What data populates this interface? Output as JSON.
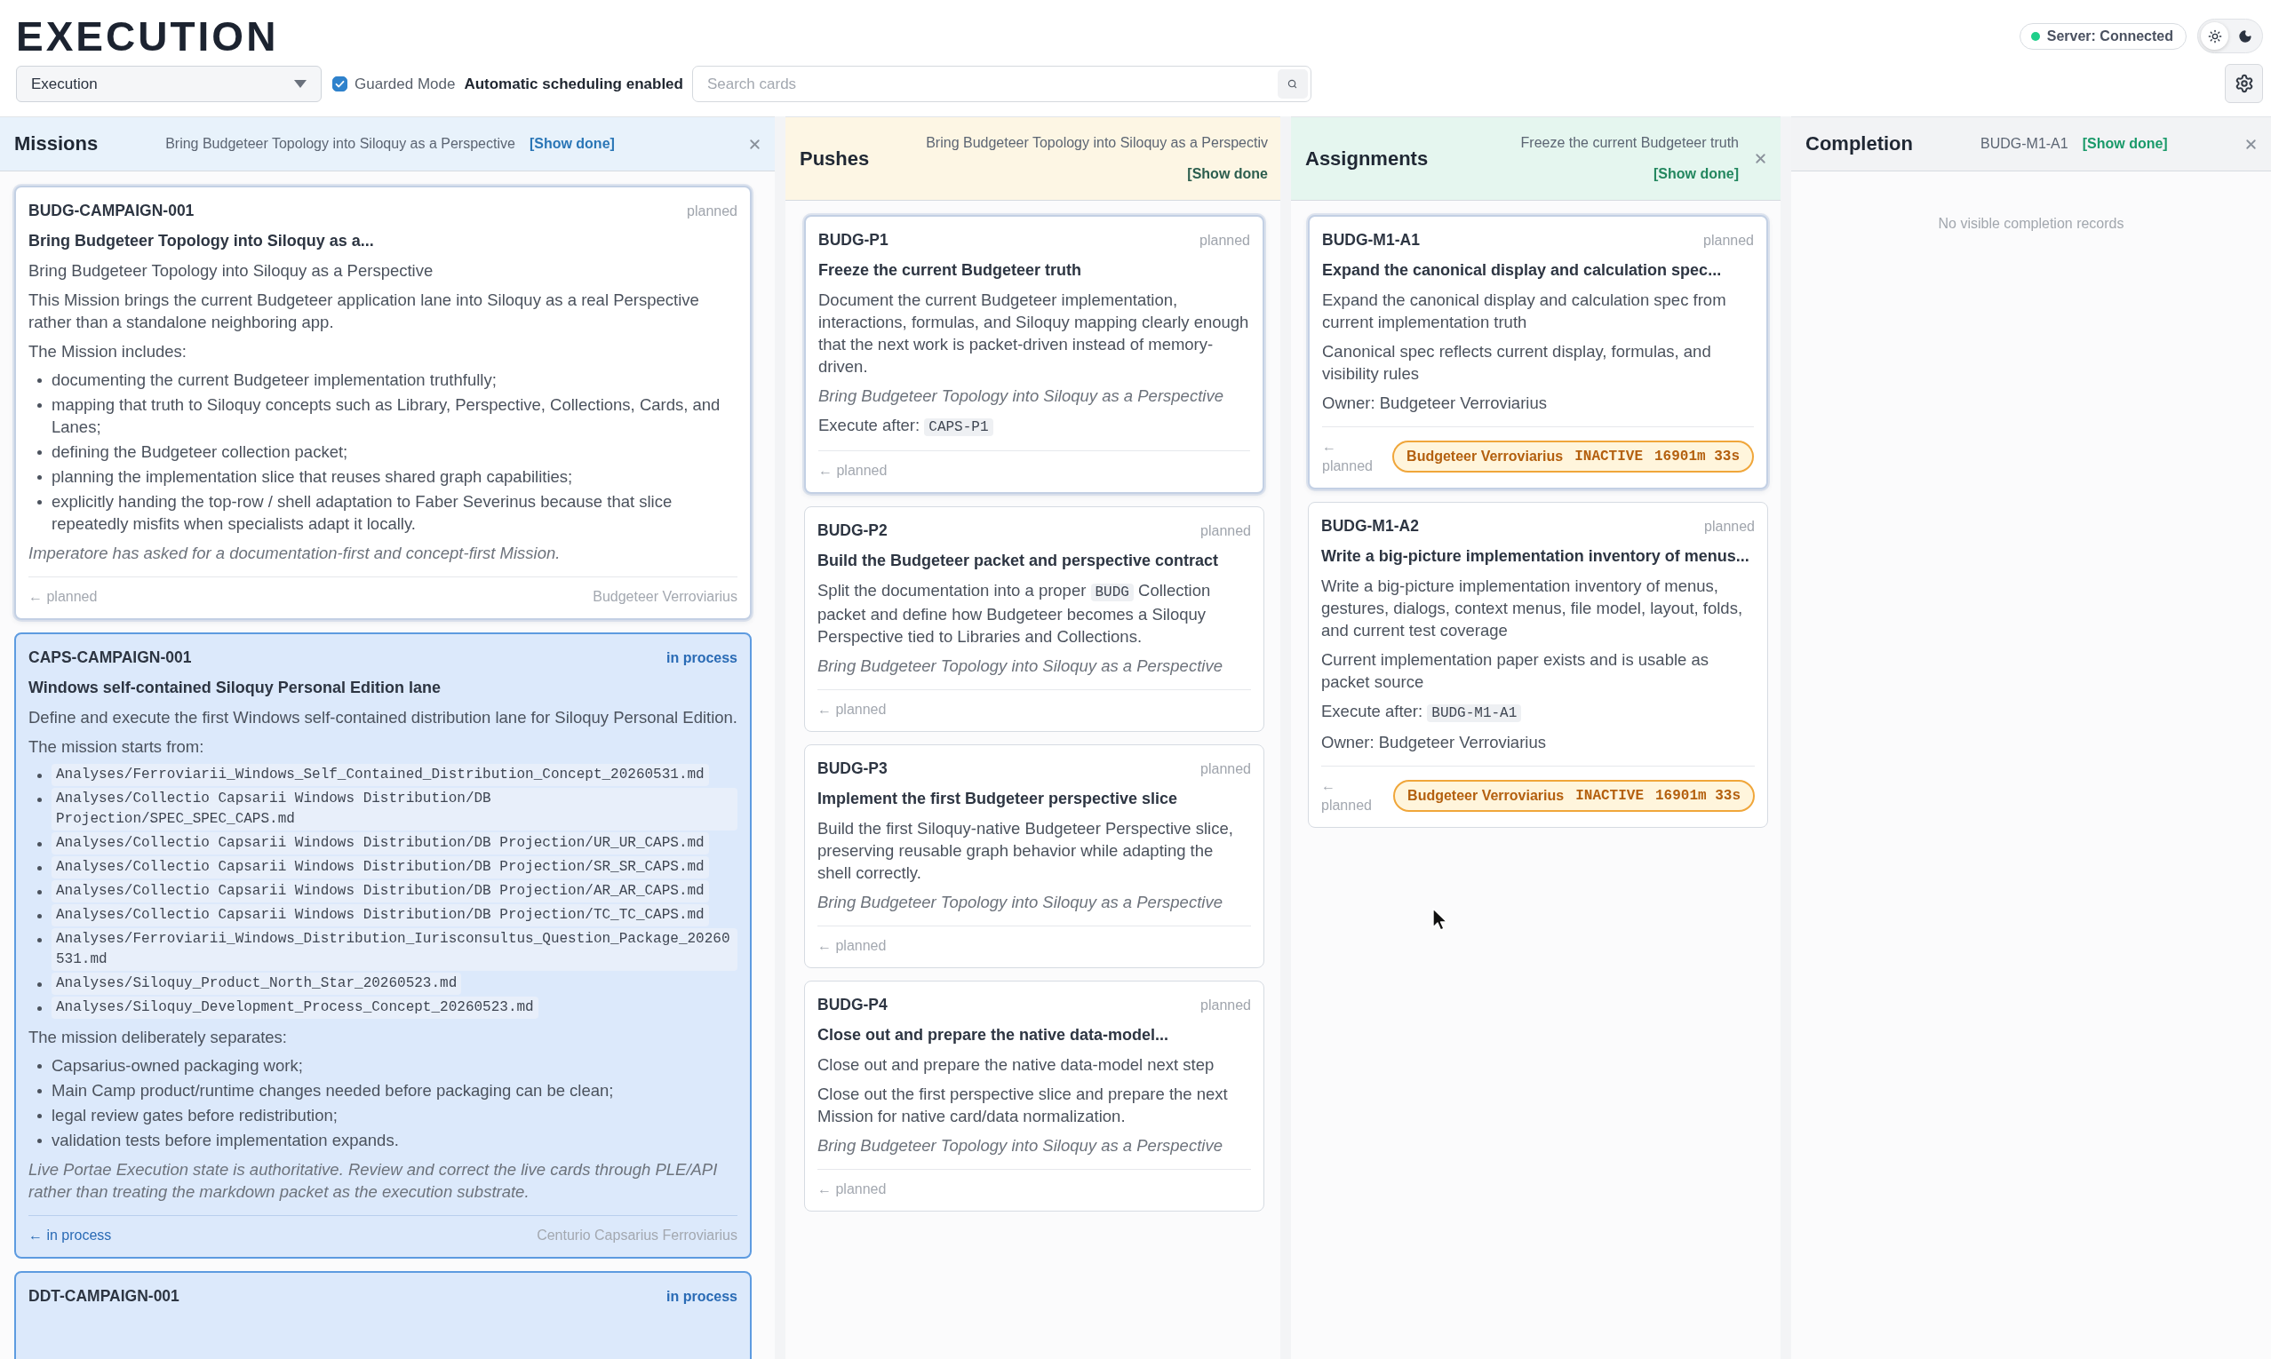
{
  "header": {
    "title": "EXECUTION",
    "view_select": {
      "value": "Execution"
    },
    "guarded_mode": {
      "label": "Guarded Mode",
      "checked": true
    },
    "scheduling": "Automatic scheduling enabled",
    "search": {
      "placeholder": "Search cards"
    },
    "server": {
      "label": "Server: Connected",
      "connected": true
    },
    "theme": [
      {
        "kind": "light",
        "selected": true
      },
      {
        "kind": "dark",
        "selected": false
      }
    ]
  },
  "columns": [
    {
      "title": "Missions",
      "color": "#e8f2fb",
      "context": "Bring Budgeteer Topology into Siloquy as a Perspective",
      "show_done": "[Show done]",
      "closable": true,
      "cards": [
        {
          "id": "BUDG-CAMPAIGN-001",
          "status": "planned",
          "active": false,
          "selected": true,
          "title": "Bring Budgeteer Topology into Siloquy as a...",
          "blocks": [
            {
              "kind": "text",
              "text": "Bring Budgeteer Topology into Siloquy as a Perspective"
            },
            {
              "kind": "text",
              "text": "This Mission brings the current Budgeteer application lane into Siloquy as a real Perspective rather than a standalone neighboring app."
            },
            {
              "kind": "text",
              "text": "The Mission includes:"
            },
            {
              "kind": "list",
              "items": [
                "documenting the current Budgeteer implementation truthfully;",
                "mapping that truth to Siloquy concepts such as Library, Perspective, Collections, Cards, and Lanes;",
                "defining the Budgeteer collection packet;",
                "planning the implementation slice that reuses shared graph capabilities;",
                "explicitly handing the top-row / shell adaptation to Faber Severinus because that slice repeatedly misfits when specialists adapt it locally."
              ]
            },
            {
              "kind": "note",
              "text": "Imperatore has asked for a documentation-first and concept-first Mission."
            }
          ],
          "back": "← planned",
          "owner": "Budgeteer Verroviarius"
        },
        {
          "id": "CAPS-CAMPAIGN-001",
          "status": "in process",
          "active": true,
          "selected": false,
          "title": "Windows self-contained Siloquy Personal Edition lane",
          "blocks": [
            {
              "kind": "text",
              "text": "Define and execute the first Windows self-contained distribution lane for Siloquy Personal Edition."
            },
            {
              "kind": "text",
              "text": "The mission starts from:"
            },
            {
              "kind": "code_list",
              "items": [
                "Analyses/Ferroviarii_Windows_Self_Contained_Distribution_Concept_20260531.md",
                "Analyses/Collectio Capsarii Windows Distribution/DB Projection/SPEC_SPEC_CAPS.md",
                "Analyses/Collectio Capsarii Windows Distribution/DB Projection/UR_UR_CAPS.md",
                "Analyses/Collectio Capsarii Windows Distribution/DB Projection/SR_SR_CAPS.md",
                "Analyses/Collectio Capsarii Windows Distribution/DB Projection/AR_AR_CAPS.md",
                "Analyses/Collectio Capsarii Windows Distribution/DB Projection/TC_TC_CAPS.md",
                "Analyses/Ferroviarii_Windows_Distribution_Iurisconsultus_Question_Package_20260531.md",
                "Analyses/Siloquy_Product_North_Star_20260523.md",
                "Analyses/Siloquy_Development_Process_Concept_20260523.md"
              ]
            },
            {
              "kind": "text",
              "text": "The mission deliberately separates:"
            },
            {
              "kind": "list",
              "items": [
                "Capsarius-owned packaging work;",
                "Main Camp product/runtime changes needed before packaging can be clean;",
                "legal review gates before redistribution;",
                "validation tests before implementation expands."
              ]
            },
            {
              "kind": "note",
              "text": "Live Portae Execution state is authoritative. Review and correct the live cards through PLE/API rather than treating the markdown packet as the execution substrate."
            }
          ],
          "back": "← in process",
          "owner": "Centurio Capsarius Ferroviarius"
        },
        {
          "id": "DDT-CAMPAIGN-001",
          "status": "in process",
          "active": true,
          "selected": false
        }
      ]
    },
    {
      "title": "Pushes",
      "color": "#fdf6e4",
      "context": "Bring Budgeteer Topology into Siloquy as a Perspectiv",
      "show_done": "[Show done",
      "cards": [
        {
          "id": "BUDG-P1",
          "status": "planned",
          "active": false,
          "selected": true,
          "title": "Freeze the current Budgeteer truth",
          "blocks": [
            {
              "kind": "text",
              "text": "Document the current Budgeteer implementation, interactions, formulas, and Siloquy mapping clearly enough that the next work is packet-driven instead of memory-driven."
            },
            {
              "kind": "note",
              "text": "Bring Budgeteer Topology into Siloquy as a Perspective"
            },
            {
              "kind": "parts",
              "parts": [
                {
                  "kind": "text",
                  "text": "Execute after: "
                },
                {
                  "kind": "code",
                  "text": "CAPS-P1"
                }
              ]
            }
          ],
          "back": "← planned"
        },
        {
          "id": "BUDG-P2",
          "status": "planned",
          "active": false,
          "selected": false,
          "title": "Build the Budgeteer packet and perspective contract",
          "blocks": [
            {
              "kind": "parts",
              "parts": [
                {
                  "kind": "text",
                  "text": "Split the documentation into a proper "
                },
                {
                  "kind": "code",
                  "text": "BUDG"
                },
                {
                  "kind": "text",
                  "text": " Collection packet and define how Budgeteer becomes a Siloquy Perspective tied to Libraries and Collections."
                }
              ]
            },
            {
              "kind": "note",
              "text": "Bring Budgeteer Topology into Siloquy as a Perspective"
            }
          ],
          "back": "← planned"
        },
        {
          "id": "BUDG-P3",
          "status": "planned",
          "active": false,
          "selected": false,
          "title": "Implement the first Budgeteer perspective slice",
          "blocks": [
            {
              "kind": "text",
              "text": "Build the first Siloquy-native Budgeteer Perspective slice, preserving reusable graph behavior while adapting the shell correctly."
            },
            {
              "kind": "note",
              "text": "Bring Budgeteer Topology into Siloquy as a Perspective"
            }
          ],
          "back": "← planned"
        },
        {
          "id": "BUDG-P4",
          "status": "planned",
          "active": false,
          "selected": false,
          "title": "Close out and prepare the native data-model...",
          "blocks": [
            {
              "kind": "text",
              "text": "Close out and prepare the native data-model next step"
            },
            {
              "kind": "text",
              "text": "Close out the first perspective slice and prepare the next Mission for native card/data normalization."
            },
            {
              "kind": "note",
              "text": "Bring Budgeteer Topology into Siloquy as a Perspective"
            }
          ],
          "back": "← planned"
        }
      ]
    },
    {
      "title": "Assignments",
      "color": "#e5f6ef",
      "context": "Freeze the current Budgeteer truth",
      "show_done": "[Show done]",
      "closable": true,
      "cards": [
        {
          "id": "BUDG-M1-A1",
          "status": "planned",
          "active": false,
          "selected": true,
          "title": "Expand the canonical display and calculation spec...",
          "blocks": [
            {
              "kind": "text",
              "text": "Expand the canonical display and calculation spec from current implementation truth"
            },
            {
              "kind": "text",
              "text": "Canonical spec reflects current display, formulas, and visibility rules"
            },
            {
              "kind": "text",
              "text": "Owner: Budgeteer Verroviarius"
            }
          ],
          "back": "← planned",
          "agent": {
            "name": "Budgeteer Verroviarius",
            "state": "INACTIVE",
            "elapsed": "16901m 33s"
          }
        },
        {
          "id": "BUDG-M1-A2",
          "status": "planned",
          "active": false,
          "selected": false,
          "title": "Write a big-picture implementation inventory of menus...",
          "blocks": [
            {
              "kind": "text",
              "text": "Write a big-picture implementation inventory of menus, gestures, dialogs, context menus, file model, layout, folds, and current test coverage"
            },
            {
              "kind": "text",
              "text": "Current implementation paper exists and is usable as packet source"
            },
            {
              "kind": "parts",
              "parts": [
                {
                  "kind": "text",
                  "text": "Execute after: "
                },
                {
                  "kind": "code",
                  "text": "BUDG-M1-A1"
                }
              ]
            },
            {
              "kind": "text",
              "text": "Owner: Budgeteer Verroviarius"
            }
          ],
          "back": "← planned",
          "agent": {
            "name": "Budgeteer Verroviarius",
            "state": "INACTIVE",
            "elapsed": "16901m 33s"
          }
        }
      ]
    },
    {
      "title": "Completion",
      "color": "#f2f3f5",
      "context": "BUDG-M1-A1",
      "show_done": "[Show done]",
      "closable": true,
      "empty_message": "No visible completion records"
    }
  ]
}
